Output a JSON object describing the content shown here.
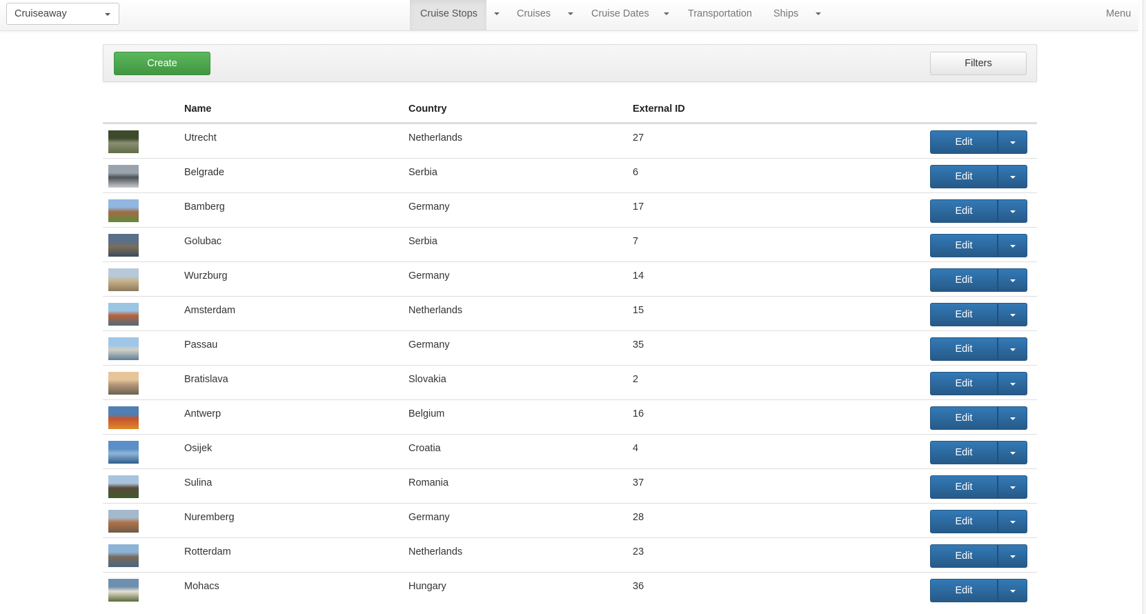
{
  "brand": {
    "selected": "Cruiseaway"
  },
  "nav": {
    "items": [
      {
        "label": "Cruise Stops",
        "active": true,
        "has_dropdown": true
      },
      {
        "label": "Cruises",
        "active": false,
        "has_dropdown": true
      },
      {
        "label": "Cruise Dates",
        "active": false,
        "has_dropdown": true
      },
      {
        "label": "Transportation",
        "active": false,
        "has_dropdown": false
      },
      {
        "label": "Ships",
        "active": false,
        "has_dropdown": true
      }
    ],
    "menu_label": "Menu"
  },
  "toolbar": {
    "create_label": "Create",
    "filters_label": "Filters"
  },
  "table": {
    "columns": [
      "Name",
      "Country",
      "External ID"
    ],
    "edit_label": "Edit",
    "rows": [
      {
        "name": "Utrecht",
        "country": "Netherlands",
        "external_id": "27",
        "thumb": [
          "#3e4a2c",
          "#8a8f74",
          "#5f6d45"
        ]
      },
      {
        "name": "Belgrade",
        "country": "Serbia",
        "external_id": "6",
        "thumb": [
          "#9aa3ad",
          "#4c5258",
          "#c9ccd0"
        ]
      },
      {
        "name": "Bamberg",
        "country": "Germany",
        "external_id": "17",
        "thumb": [
          "#8fb7e0",
          "#a36b45",
          "#5f8a3c"
        ]
      },
      {
        "name": "Golubac",
        "country": "Serbia",
        "external_id": "7",
        "thumb": [
          "#5a6f88",
          "#7c6e58",
          "#3c4b5c"
        ]
      },
      {
        "name": "Wurzburg",
        "country": "Germany",
        "external_id": "14",
        "thumb": [
          "#b7c9d9",
          "#c9b28a",
          "#8b7a5e"
        ]
      },
      {
        "name": "Amsterdam",
        "country": "Netherlands",
        "external_id": "15",
        "thumb": [
          "#9cc4e3",
          "#b9623a",
          "#4e6a80"
        ]
      },
      {
        "name": "Passau",
        "country": "Germany",
        "external_id": "35",
        "thumb": [
          "#9fc6e6",
          "#d2cfc4",
          "#5c7e98"
        ]
      },
      {
        "name": "Bratislava",
        "country": "Slovakia",
        "external_id": "2",
        "thumb": [
          "#e7c59a",
          "#b79779",
          "#6d6252"
        ]
      },
      {
        "name": "Antwerp",
        "country": "Belgium",
        "external_id": "16",
        "thumb": [
          "#4f7fb4",
          "#c7542d",
          "#e08a2a"
        ]
      },
      {
        "name": "Osijek",
        "country": "Croatia",
        "external_id": "4",
        "thumb": [
          "#5a8fc7",
          "#8fb5d9",
          "#2f5c8a"
        ]
      },
      {
        "name": "Sulina",
        "country": "Romania",
        "external_id": "37",
        "thumb": [
          "#a8c4dc",
          "#5a4a3a",
          "#3e5a2c"
        ]
      },
      {
        "name": "Nuremberg",
        "country": "Germany",
        "external_id": "28",
        "thumb": [
          "#a5b9cc",
          "#b0734a",
          "#6f5a48"
        ]
      },
      {
        "name": "Rotterdam",
        "country": "Netherlands",
        "external_id": "23",
        "thumb": [
          "#8db3d6",
          "#7a6a5a",
          "#4a6680"
        ]
      },
      {
        "name": "Mohacs",
        "country": "Hungary",
        "external_id": "36",
        "thumb": [
          "#6f8fae",
          "#e6e0d2",
          "#5c6b3a"
        ]
      }
    ]
  }
}
